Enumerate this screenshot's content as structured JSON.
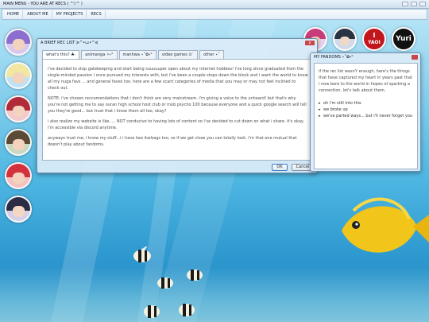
{
  "window": {
    "title": "MAIN MENU - YOU ARE AT RECS ( ^▽^ )"
  },
  "menu": {
    "items": [
      "HOME",
      "ABOUT ME",
      "MY PROJECTS",
      "RECS"
    ]
  },
  "top_icons": [
    {
      "icon": "character-avatar-icon"
    },
    {
      "icon": "character-avatar-icon"
    },
    {
      "icon": "yaoi-heart-icon",
      "text_top": "I",
      "text_bottom": "YAOI"
    },
    {
      "icon": "yuri-icon",
      "text": "Yuri"
    }
  ],
  "side_avatars": [
    {
      "icon": "character-avatar-icon"
    },
    {
      "icon": "character-avatar-icon"
    },
    {
      "icon": "character-avatar-icon"
    },
    {
      "icon": "character-avatar-icon"
    },
    {
      "icon": "character-avatar-icon"
    },
    {
      "icon": "character-avatar-icon"
    }
  ],
  "main_window": {
    "title": "A BRIEF REC LIST ≽^•⩊•^≼",
    "close_label": "x",
    "tabs": [
      {
        "label": "what's this? ♣·"
      },
      {
        "label": "animanga ✧˖°"
      },
      {
        "label": "manhwa ⋆˚✿˖°"
      },
      {
        "label": "video games ⊙˙"
      },
      {
        "label": "other ⋆˚"
      }
    ],
    "paragraphs": [
      "i've decided to stop gatekeeping and start being suuuuuper open about my internet hobbies! i've long since graduated from the single-minded passion i once pursued my interests with, but i've been a couple steps down the block and i want the world to know all my nuga favs ... and general faves too. here are a few scant categories of media that you may or may not feel inclined to check out.",
      "NOTE: i've chosen reccomendations that i don't think are very mainstream. i'm giving a voice to the unheard! but that's why you're not getting me to say ouran high school host club or mob psycho 100 because everyone and a quick google search will tell you they're good... but trust that i know them all too, okay?",
      "i also realize my website is like..... NOT conducive to having lots of content so i've decided to cut down on what i share. it's okay. i'm accessible via discord anytime.",
      "anyways trust me, i know my stuff...i i have two itarbags too, so if we get close you can totally look. i'm that one mutual that doesn't play about fandoms."
    ],
    "ok_label": "OK",
    "cancel_label": "Cancel"
  },
  "fandoms_window": {
    "title": "MY FANDOMS ⋆˚✿˖°",
    "intro": "if the rec list wasn't enough, here's the things that have captured my heart in years past that i now bare to the world in hopes of sparking a connection. let's talk about them.",
    "items": [
      {
        "label": "oh i'm still into this"
      },
      {
        "label": "we broke up"
      },
      {
        "label": "we've parted ways... but i'll never forget you"
      }
    ]
  },
  "colors": {
    "accent": "#3f7fc4",
    "window_bg": "#dcebf8",
    "close": "#c9464a",
    "yaoi_bg": "#c2161c",
    "yuri_bg": "#111111"
  }
}
